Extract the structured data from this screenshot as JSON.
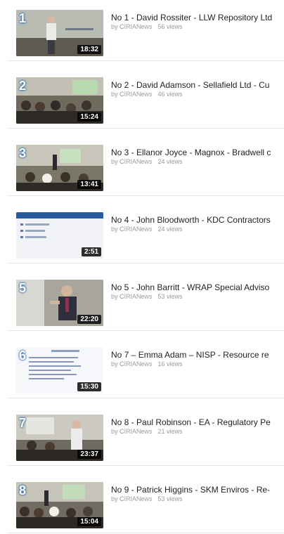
{
  "videos": [
    {
      "number": "1",
      "title": "No 1 - David Rossiter - LLW Repository Ltd",
      "byline": "by CIRIANews",
      "views": "56 views",
      "duration": "18:32"
    },
    {
      "number": "2",
      "title": "No 2 - David Adamson - Sellafield Ltd - Cu",
      "byline": "by CIRIANews",
      "views": "46 views",
      "duration": "15:24"
    },
    {
      "number": "3",
      "title": "No 3 - Ellanor Joyce - Magnox - Bradwell c",
      "byline": "by CIRIANews",
      "views": "24 views",
      "duration": "13:41"
    },
    {
      "number": "4",
      "title": "No 4 - John Bloodworth - KDC Contractors",
      "byline": "by CIRIANews",
      "views": "24 views",
      "duration": "2:51"
    },
    {
      "number": "5",
      "title": "No 5 - John Barritt - WRAP Special Adviso",
      "byline": "by CIRIANews",
      "views": "53 views",
      "duration": "22:20"
    },
    {
      "number": "6",
      "title": "No 7 – Emma Adam – NISP - Resource re",
      "byline": "by CIRIANews",
      "views": "16 views",
      "duration": "15:30"
    },
    {
      "number": "7",
      "title": "No 8 - Paul Robinson - EA - Regulatory Pe",
      "byline": "by CIRIANews",
      "views": "21 views",
      "duration": "23:37"
    },
    {
      "number": "8",
      "title": "No 9 - Patrick Higgins - SKM Enviros - Re-",
      "byline": "by CIRIANews",
      "views": "53 views",
      "duration": "15:04"
    }
  ]
}
